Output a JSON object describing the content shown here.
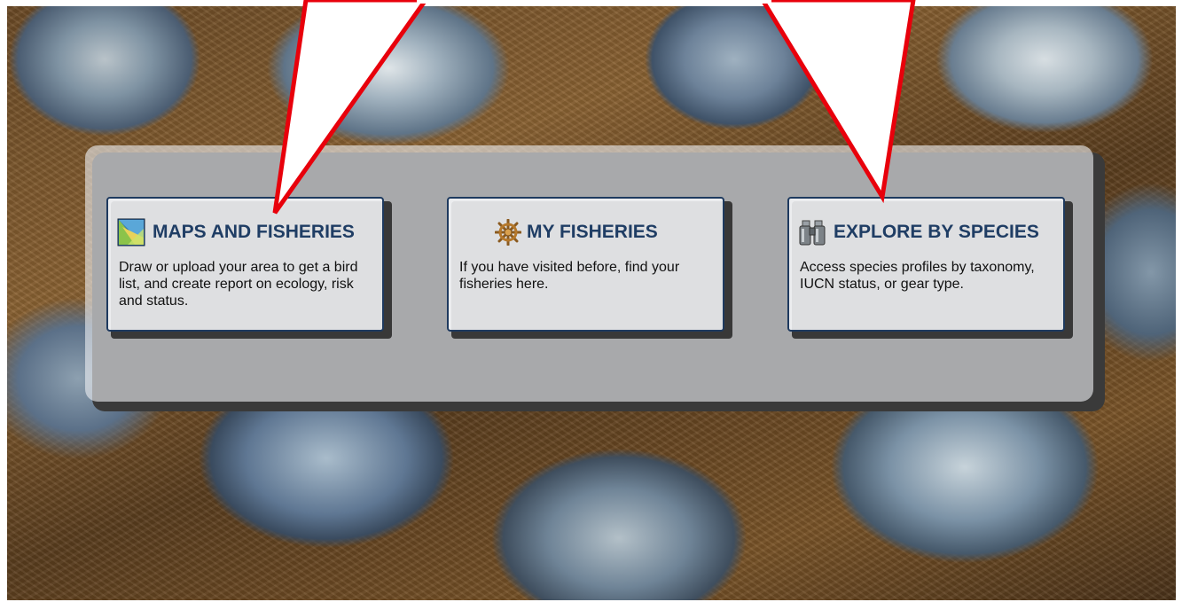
{
  "cards": [
    {
      "icon": "map-icon",
      "title": "MAPS AND FISHERIES",
      "description": "Draw or upload your area to get a bird list, and create report on ecology, risk and status."
    },
    {
      "icon": "ship-wheel-icon",
      "title": "MY FISHERIES",
      "description": "If you have visited before, find your fisheries here."
    },
    {
      "icon": "binoculars-icon",
      "title": "EXPLORE BY SPECIES",
      "description": "Access species profiles by taxonomy, IUCN status, or gear type."
    }
  ],
  "colors": {
    "title_text": "#1f3d64",
    "card_border": "#1e3a5f",
    "callout_stroke": "#e8000b"
  }
}
